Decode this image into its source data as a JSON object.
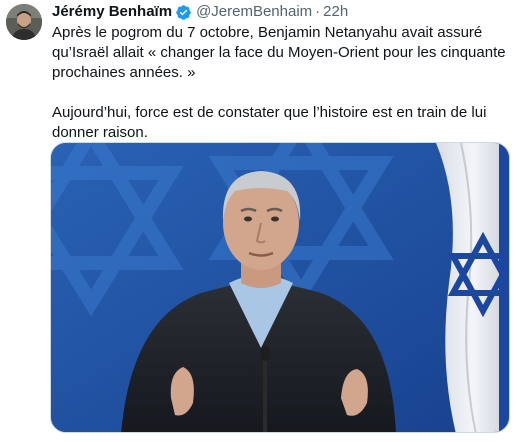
{
  "tweet": {
    "author_name": "Jérémy Benhaïm",
    "handle": "@JeremBenhaim",
    "separator": "·",
    "time": "22h",
    "paragraph_1": "Après le pogrom du 7 octobre, Benjamin Netanyahu avait assuré qu’Israël allait « changer la face du Moyen-Orient pour les cinquante prochaines années. »",
    "paragraph_2": "Aujourd’hui, force est de constater que l’histoire est en train de lui donner raison.",
    "verified_badge_icon": "verified-badge-icon",
    "media": {
      "type": "photo",
      "background_color": "#1f56a8",
      "flag_color": "#1c47a0"
    }
  },
  "colors": {
    "text_primary": "#0f1419",
    "text_secondary": "#536471",
    "verified_blue": "#1d9bf0",
    "border": "#cfd9de"
  }
}
